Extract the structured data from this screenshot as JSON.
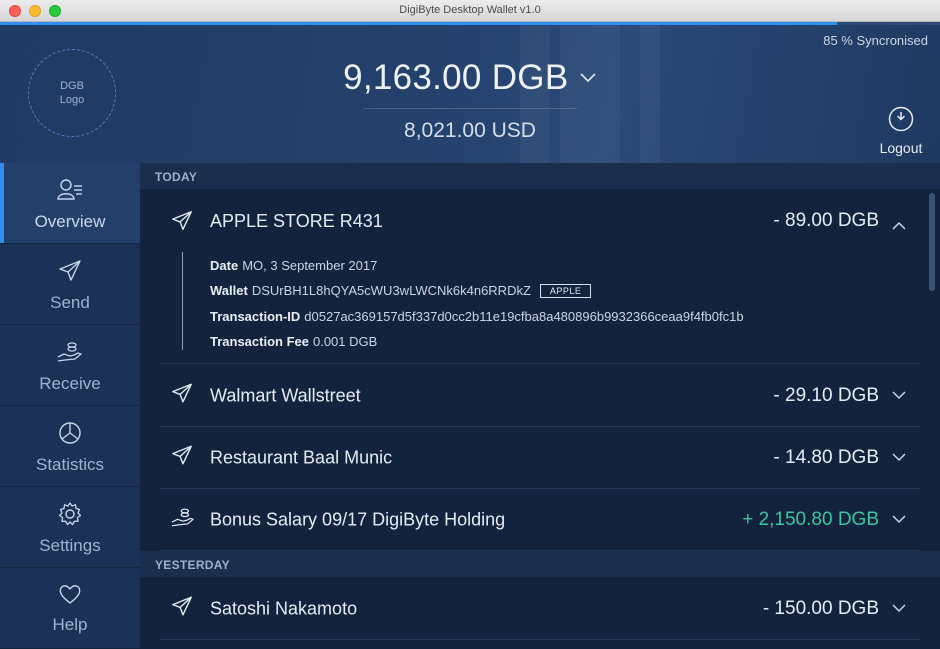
{
  "window": {
    "title": "DigiByte Desktop Wallet v1.0"
  },
  "header": {
    "sync_percent": 0.89,
    "sync_text": "85 % Syncronised",
    "logo_line1": "DGB",
    "logo_line2": "Logo",
    "balance": "9,163.00 DGB",
    "fiat_balance": "8,021.00 USD",
    "logout_label": "Logout"
  },
  "sidebar": {
    "items": [
      {
        "label": "Overview",
        "icon": "overview-icon",
        "active": true
      },
      {
        "label": "Send",
        "icon": "send-icon"
      },
      {
        "label": "Receive",
        "icon": "receive-icon"
      },
      {
        "label": "Statistics",
        "icon": "statistics-icon"
      },
      {
        "label": "Settings",
        "icon": "gear-icon"
      },
      {
        "label": "Help",
        "icon": "heart-icon"
      }
    ]
  },
  "sections": {
    "today": "TODAY",
    "yesterday": "YESTERDAY"
  },
  "transactions": {
    "expanded": {
      "name": "APPLE STORE R431",
      "amount": "- 89.00 DGB",
      "date_label": "Date",
      "date": "MO, 3 September 2017",
      "wallet_label": "Wallet",
      "wallet": "DSUrBH1L8hQYA5cWU3wLWCNk6k4n6RRDkZ",
      "wallet_tag": "APPLE",
      "txid_label": "Transaction-ID",
      "txid": "d0527ac369157d5f337d0cc2b11e19cfba8a480896b9932366ceaa9f4fb0fc1b",
      "fee_label": "Transaction Fee",
      "fee": "0.001 DGB"
    },
    "today": [
      {
        "name": "Walmart Wallstreet",
        "amount": "- 29.10 DGB",
        "type": "send"
      },
      {
        "name": "Restaurant Baal Munic",
        "amount": "- 14.80 DGB",
        "type": "send"
      },
      {
        "name": "Bonus Salary 09/17 DigiByte Holding",
        "amount": "+ 2,150.80 DGB",
        "type": "receive"
      }
    ],
    "yesterday": [
      {
        "name": "Satoshi Nakamoto",
        "amount": "- 150.00 DGB",
        "type": "send"
      }
    ]
  },
  "colors": {
    "accent": "#2f8ff0",
    "positive": "#39c6a0",
    "background": "#14233d",
    "sidebar": "#1b3155"
  }
}
